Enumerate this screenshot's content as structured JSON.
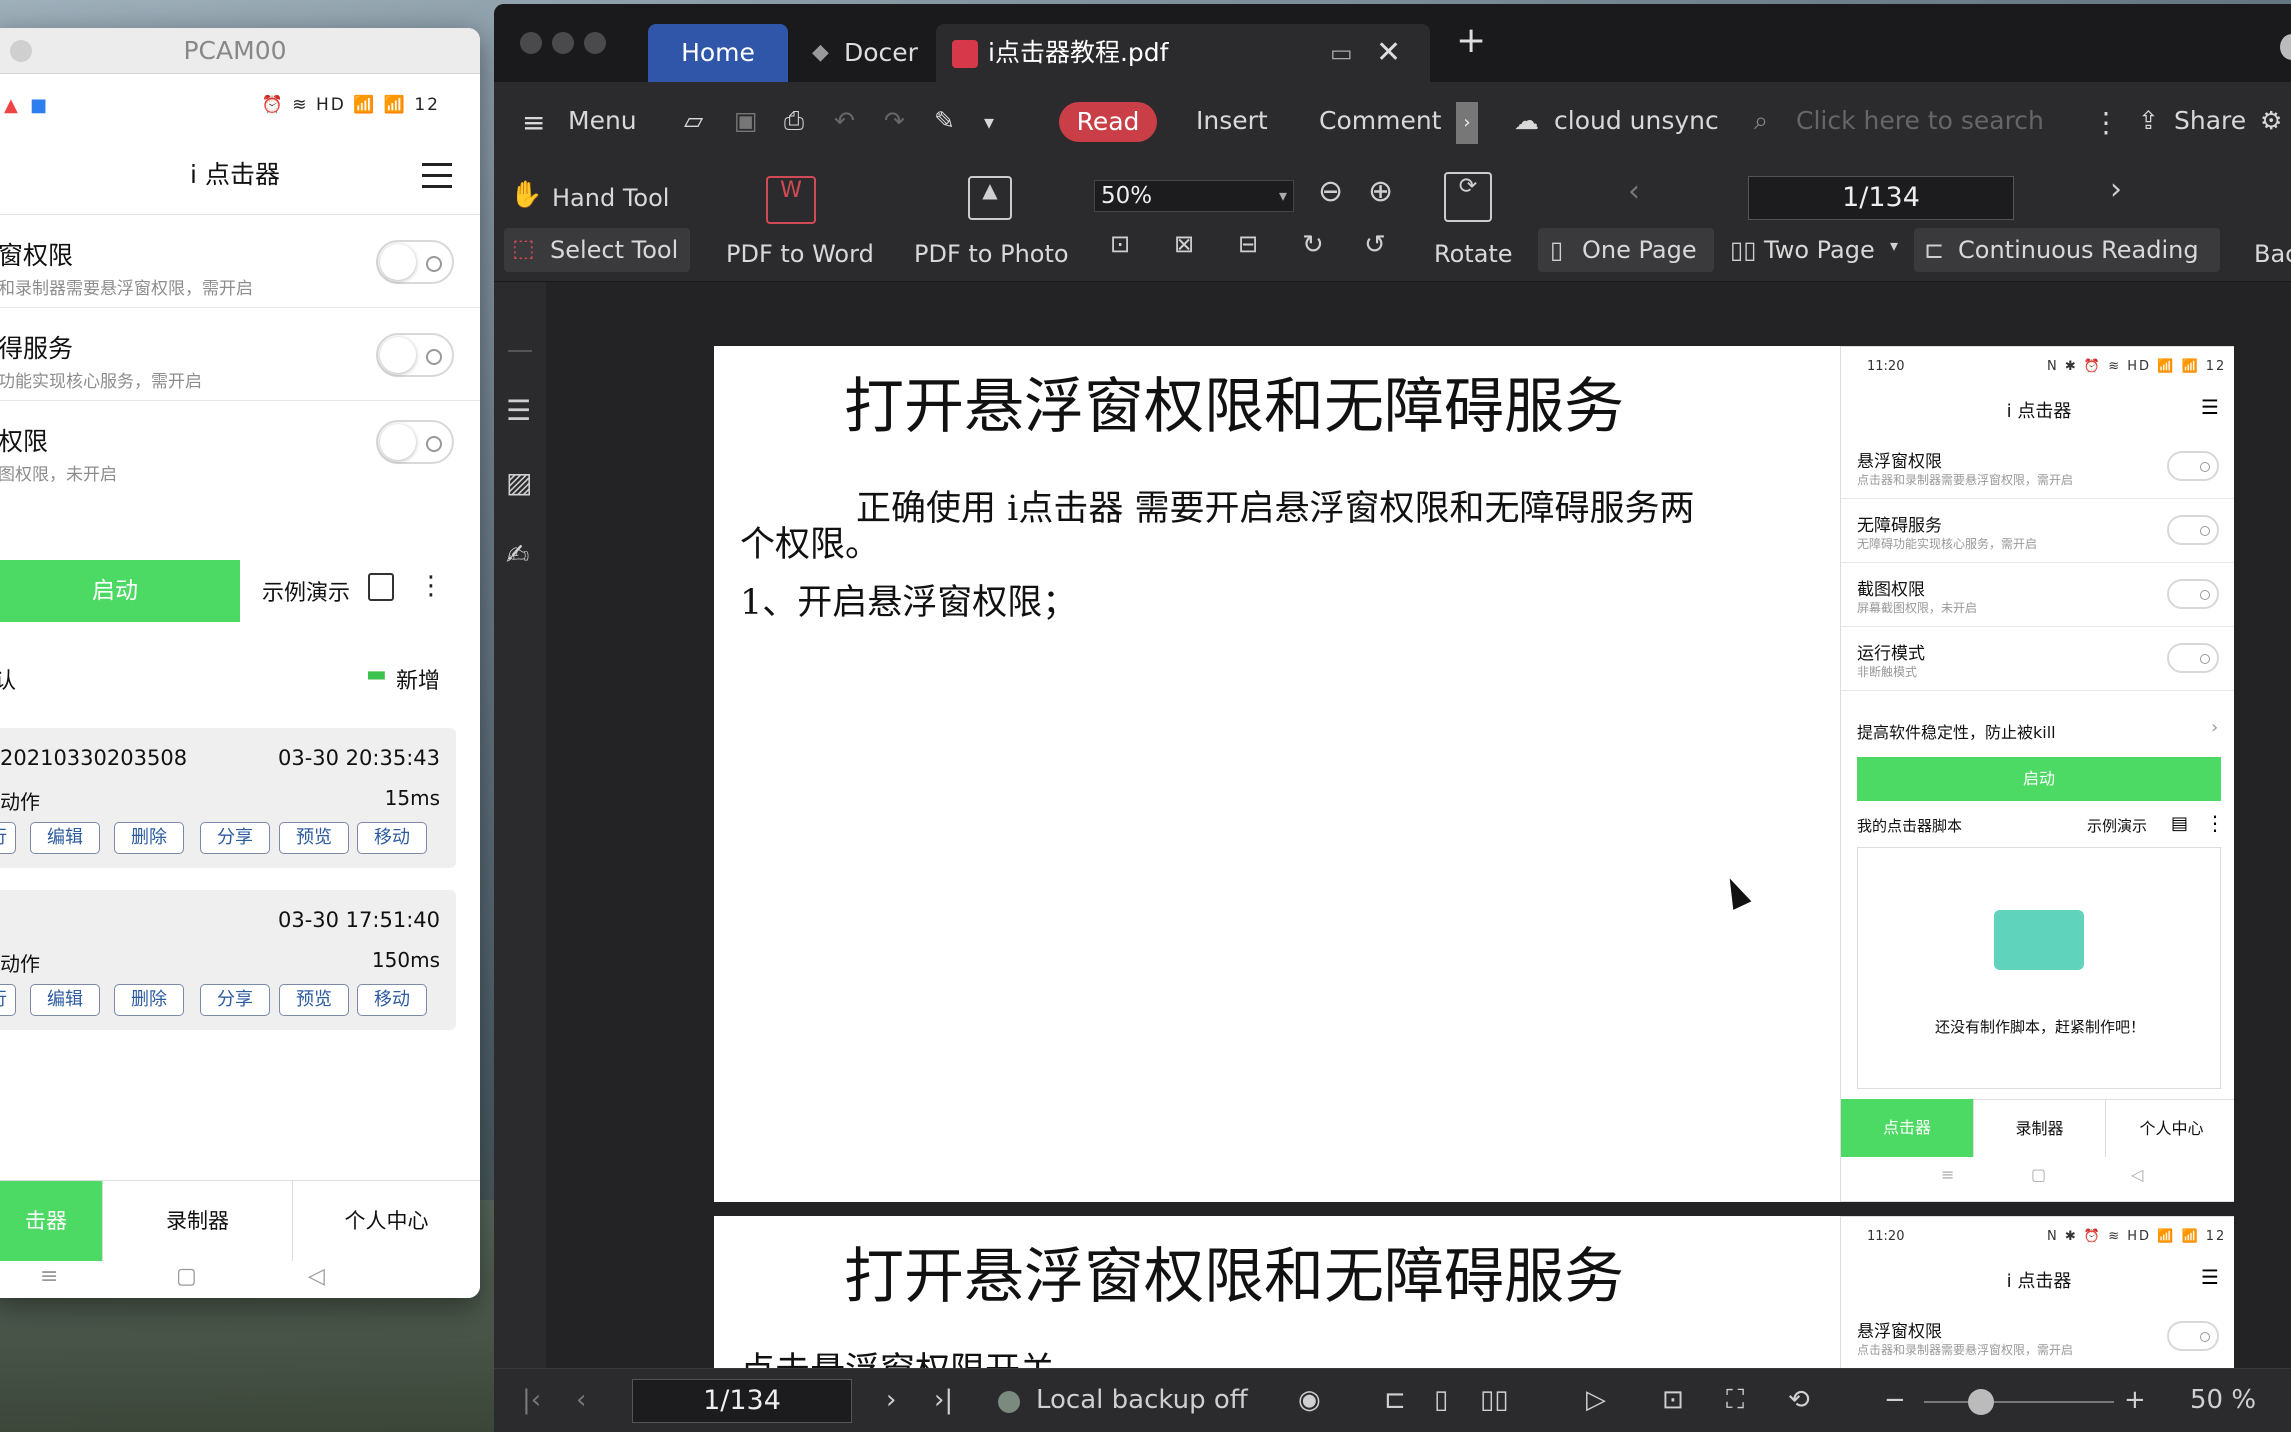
{
  "phone": {
    "window_title": "PCAM00",
    "status_right": "⏰ ≋ HD 📶 📶 12",
    "app_title": "i 点击器",
    "perms": [
      {
        "title": "窗权限",
        "sub": "和录制器需要悬浮窗权限，需开启"
      },
      {
        "title": "得服务",
        "sub": "功能实现核心服务，需开启"
      },
      {
        "title": "权限",
        "sub": "图权限，未开启"
      }
    ],
    "start_label": "启动",
    "demo_label": "示例演示",
    "section_left": "认",
    "add_label": "新增",
    "scripts": [
      {
        "name": "20210330203508",
        "time": "03-30 20:35:43",
        "actions": "动作",
        "duration": "15ms"
      },
      {
        "name": "",
        "time": "03-30 17:51:40",
        "actions": "动作",
        "duration": "150ms"
      }
    ],
    "card_buttons": [
      "行",
      "编辑",
      "删除",
      "分享",
      "预览",
      "移动"
    ],
    "tabs": [
      "击器",
      "录制器",
      "个人中心"
    ]
  },
  "wps": {
    "tabs": {
      "home": "Home",
      "docer": "Docer",
      "doc": "i点击器教程.pdf"
    },
    "ribbon1": {
      "menu": "Menu",
      "read": "Read",
      "insert": "Insert",
      "comment": "Comment",
      "cloud": "cloud unsync",
      "search_placeholder": "Click here to search",
      "share": "Share"
    },
    "ribbon2": {
      "hand_tool": "Hand Tool",
      "select_tool": "Select Tool",
      "pdf_to_word": "PDF to Word",
      "pdf_to_photo": "PDF to Photo",
      "zoom": "50%",
      "rotate": "Rotate",
      "page": "1/134",
      "one_page": "One Page",
      "two_page": "Two Page",
      "continuous": "Continuous Reading",
      "back": "Bac"
    },
    "page1": {
      "title": "打开悬浮窗权限和无障碍服务",
      "para1a": "正确使用 i点击器 需要开启悬浮窗权限和无障碍服务两",
      "para1b": "个权限。",
      "step1": "1、开启悬浮窗权限；"
    },
    "page2": {
      "title": "打开悬浮窗权限和无障碍服务",
      "para": "点击悬浮窗权限开关"
    },
    "mini": {
      "time": "11:20",
      "status_right": "N ✱ ⏰ ≋ HD 📶 📶 12",
      "app_title": "i 点击器",
      "rows": [
        {
          "title": "悬浮窗权限",
          "sub": "点击器和录制器需要悬浮窗权限，需开启"
        },
        {
          "title": "无障碍服务",
          "sub": "无障碍功能实现核心服务，需开启"
        },
        {
          "title": "截图权限",
          "sub": "屏幕截图权限，未开启"
        },
        {
          "title": "运行模式",
          "sub": "非断触模式"
        }
      ],
      "stability": "提高软件稳定性，防止被kill",
      "start": "启动",
      "my_scripts": "我的点击器脚本",
      "demo": "示例演示",
      "empty": "还没有制作脚本，赶紧制作吧！",
      "tabs": [
        "点击器",
        "录制器",
        "个人中心"
      ]
    },
    "status": {
      "page": "1/134",
      "backup": "Local backup off",
      "zoom": "50 %"
    }
  }
}
